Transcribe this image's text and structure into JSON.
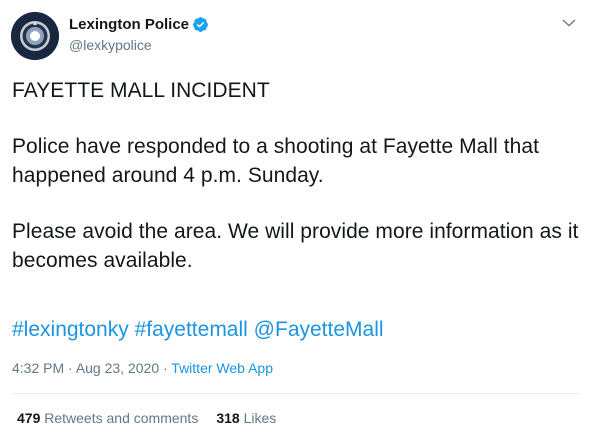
{
  "account": {
    "display_name": "Lexington Police",
    "handle": "@lexkypolice",
    "avatar_icon": "police-badge-icon",
    "verified_icon": "verified-badge-icon"
  },
  "tweet": {
    "paragraphs": [
      "FAYETTE MALL INCIDENT",
      "Police have responded to a shooting at Fayette Mall that happened around 4 p.m. Sunday.",
      "Please avoid the area. We will provide more information as it becomes available."
    ],
    "links": [
      "#lexingtonky",
      "#fayettemall",
      "@FayetteMall"
    ],
    "timestamp": "4:32 PM · Aug 23, 2020 · ",
    "source_app": "Twitter Web App"
  },
  "stats": {
    "retweets_count": "479",
    "retweets_label": "Retweets and comments",
    "likes_count": "318",
    "likes_label": "Likes"
  },
  "colors": {
    "link": "#1b95e0",
    "verified": "#1da1f2",
    "secondary_text": "#657786",
    "primary_text": "#14171a"
  },
  "icons": {
    "more": "chevron-down-icon"
  }
}
